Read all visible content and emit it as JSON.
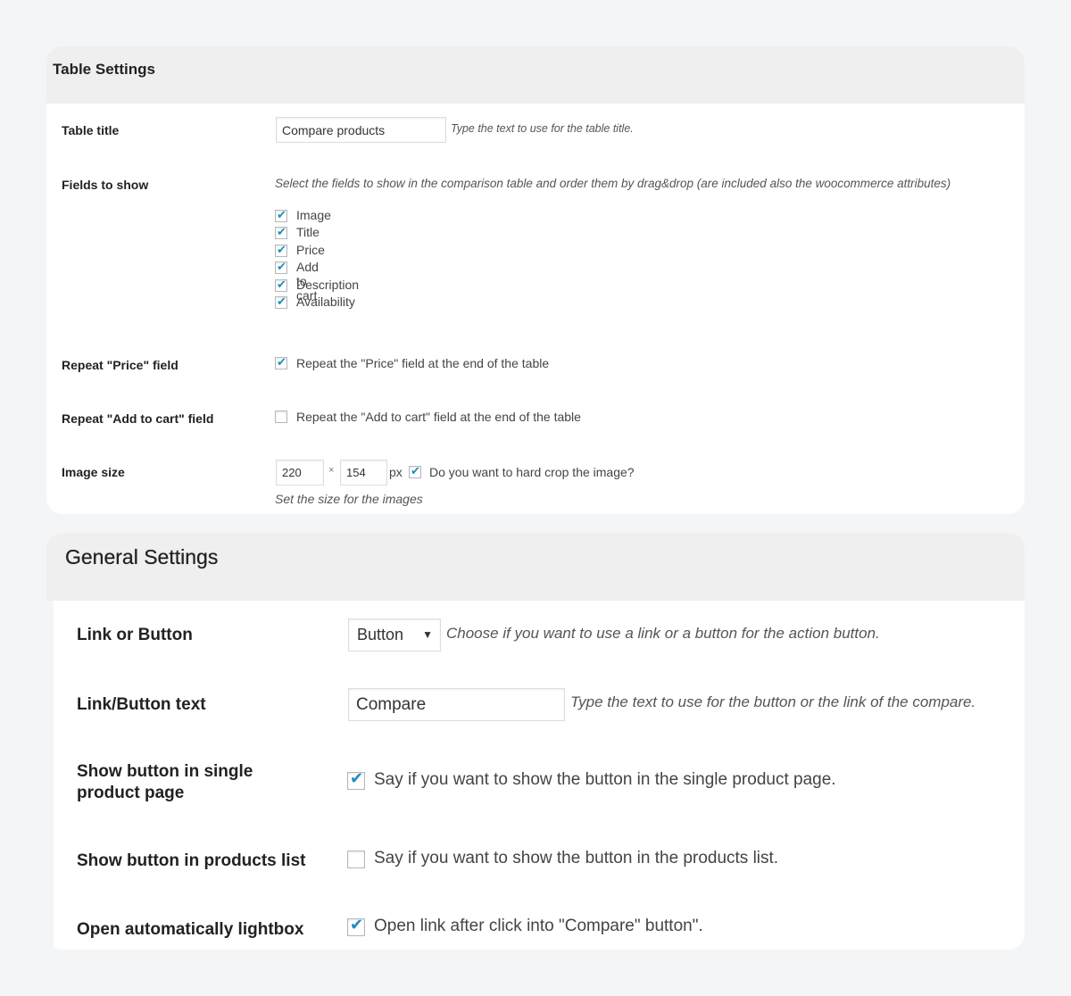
{
  "table_settings": {
    "title": "Table Settings",
    "table_title": {
      "label": "Table title",
      "value": "Compare products",
      "description": "Type the text to use for the table title."
    },
    "fields_to_show": {
      "label": "Fields to show",
      "description": "Select the fields to show in the comparison table and order them by drag&drop (are included also the woocommerce attributes)",
      "items": [
        {
          "label": "Image",
          "checked": true
        },
        {
          "label": "Title",
          "checked": true
        },
        {
          "label": "Price",
          "checked": true
        },
        {
          "label": "Add to cart",
          "checked": true
        },
        {
          "label": "Description",
          "checked": true
        },
        {
          "label": "Availability",
          "checked": true
        }
      ]
    },
    "repeat_price": {
      "label": "Repeat \"Price\" field",
      "checkbox_label": "Repeat the \"Price\" field at the end of the table",
      "checked": true
    },
    "repeat_add_to_cart": {
      "label": "Repeat \"Add to cart\" field",
      "checkbox_label": "Repeat the \"Add to cart\" field at the end of the table",
      "checked": false
    },
    "image_size": {
      "label": "Image size",
      "width": "220",
      "times": "×",
      "height": "154",
      "unit": "px",
      "crop_label": "Do you want to hard crop the image?",
      "crop_checked": true,
      "description": "Set the size for the images"
    }
  },
  "general_settings": {
    "title": "General Settings",
    "link_or_button": {
      "label": "Link or Button",
      "selected": "Button",
      "description": "Choose if you want to use a link or a button for the action button."
    },
    "button_text": {
      "label": "Link/Button text",
      "value": "Compare",
      "description": "Type the text to use for the button or the link of the compare."
    },
    "show_single": {
      "label": "Show button in single product page",
      "checkbox_label": "Say if you want to show the button in the single product page.",
      "checked": true
    },
    "show_list": {
      "label": "Show button in products list",
      "checkbox_label": "Say if you want to show the button in the products list.",
      "checked": false
    },
    "lightbox": {
      "label": "Open automatically lightbox",
      "checkbox_label": "Open link after click into \"Compare\" button\".",
      "checked": true
    }
  },
  "colors": {
    "checkmark": "#1e8cbe",
    "header_bg": "#efefef",
    "page_bg": "#f4f5f7"
  }
}
